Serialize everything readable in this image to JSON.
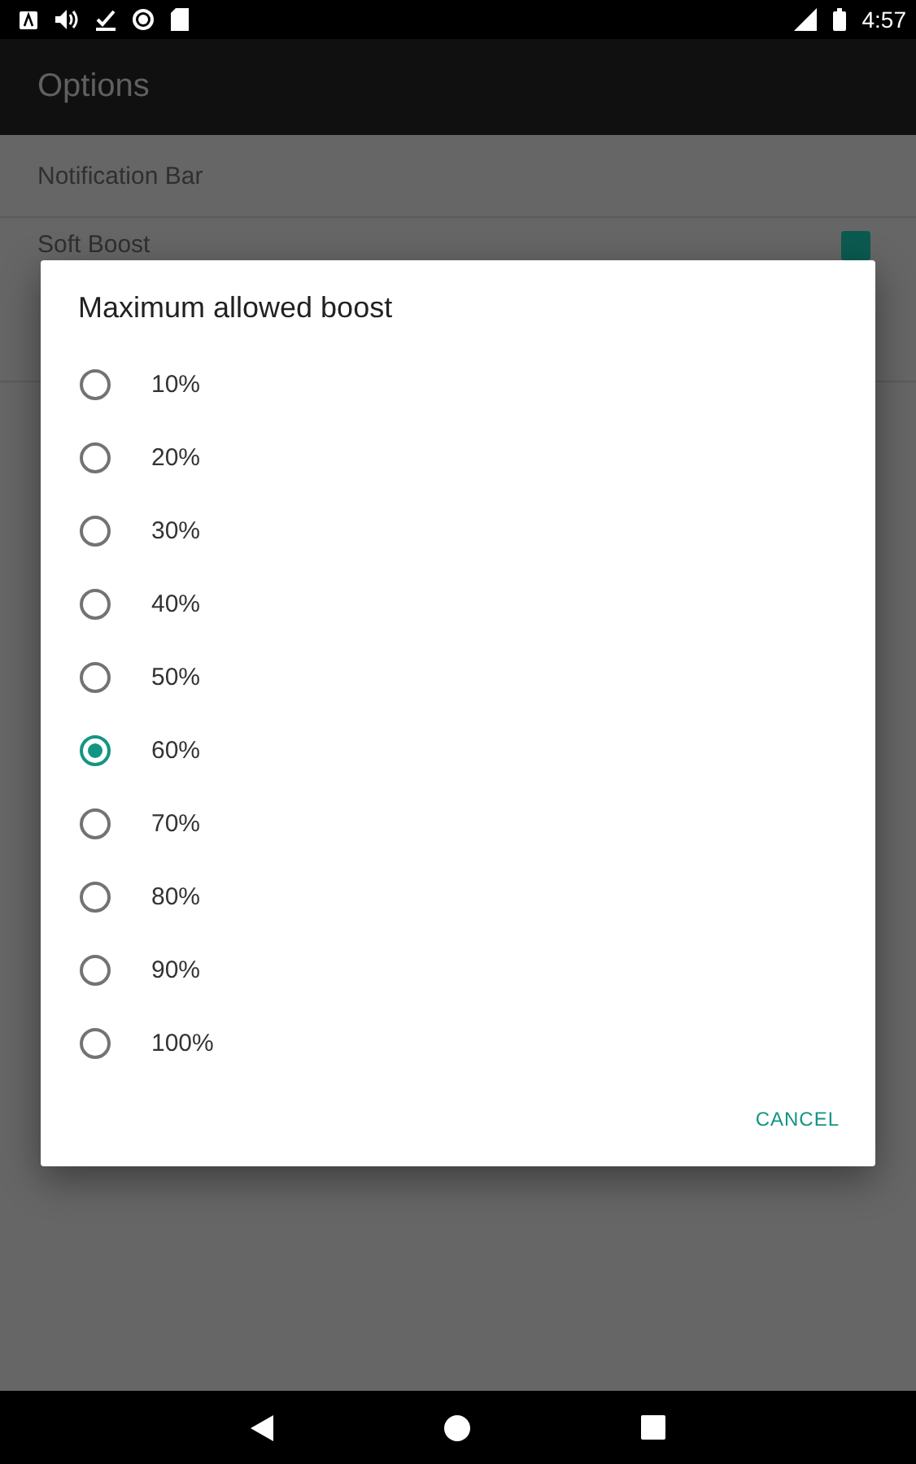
{
  "status_bar": {
    "time": "4:57"
  },
  "toolbar": {
    "title": "Options"
  },
  "settings": [
    {
      "label": "Notification Bar"
    },
    {
      "label": "Soft Boost",
      "checked": true
    }
  ],
  "dialog": {
    "title": "Maximum allowed boost",
    "options": [
      {
        "label": "10%",
        "selected": false
      },
      {
        "label": "20%",
        "selected": false
      },
      {
        "label": "30%",
        "selected": false
      },
      {
        "label": "40%",
        "selected": false
      },
      {
        "label": "50%",
        "selected": false
      },
      {
        "label": "60%",
        "selected": true
      },
      {
        "label": "70%",
        "selected": false
      },
      {
        "label": "80%",
        "selected": false
      },
      {
        "label": "90%",
        "selected": false
      },
      {
        "label": "100%",
        "selected": false
      }
    ],
    "buttons": [
      "CANCEL"
    ]
  }
}
